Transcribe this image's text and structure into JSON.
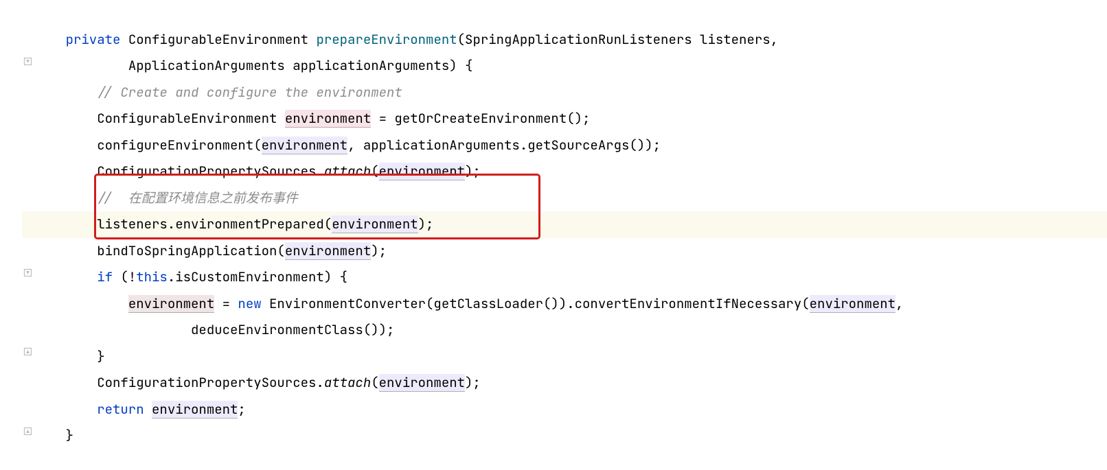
{
  "kw_private": "private",
  "t_ConfEnv": "ConfigurableEnvironment",
  "m_prepareEnv": "prepareEnvironment",
  "sig_tail1": "(SpringApplicationRunListeners listeners,",
  "sig_tail2": "ApplicationArguments applicationArguments) {",
  "comment1": "// Create and configure the environment",
  "env": "environment",
  "assign1_tail": " = getOrCreateEnvironment();",
  "l4_a": "configureEnvironment(",
  "l4_b": ", applicationArguments.getSourceArgs());",
  "l5_a": "ConfigurationPropertySources.",
  "attach": "attach",
  "paren_open": "(",
  "paren_close_semi": ");",
  "comment2": "//  在配置环境信息之前发布事件",
  "l7_a": "listeners.environmentPrepared(",
  "l8_a": "bindToSpringApplication(",
  "kw_if": "if",
  "l9_a": " (!",
  "kw_this": "this",
  "l9_b": ".isCustomEnvironment) {",
  "eq_new_sp": " = ",
  "kw_new": "new",
  "l10_a": " EnvironmentConverter(getClassLoader()).convertEnvironmentIfNecessary(",
  "comma": ",",
  "l11": "deduceEnvironmentClass());",
  "brace_close": "}",
  "kw_return": "return",
  "semi": ";"
}
